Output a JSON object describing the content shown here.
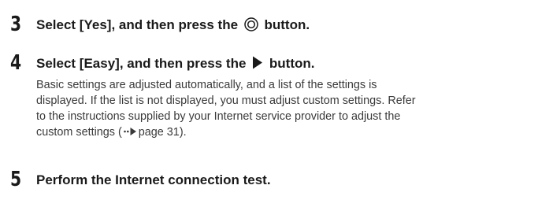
{
  "steps": [
    {
      "number": "3",
      "title_before_icon": "Select [Yes], and then press the",
      "icon": "circle-button-icon",
      "title_after_icon": "button."
    },
    {
      "number": "4",
      "title_before_icon": "Select [Easy], and then press the",
      "icon": "right-arrow-icon",
      "title_after_icon": "button.",
      "body_lines": [
        "Basic settings are adjusted automatically, and a list of the settings is",
        "displayed. If the list is not displayed, you must adjust custom settings. Refer",
        "to the instructions supplied by your Internet service provider to adjust the"
      ],
      "body_last_line_before_icon": "custom settings (",
      "page_ref_icon": "page-reference-icon",
      "page_ref_text": "page 31",
      "body_last_line_after_ref": ")."
    },
    {
      "number": "5",
      "title_before_icon": "Perform the Internet connection test."
    }
  ]
}
